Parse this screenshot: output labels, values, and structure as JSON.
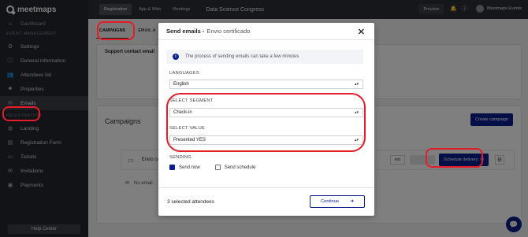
{
  "app": {
    "logo_text": "meetmaps"
  },
  "sidebar": {
    "partial_item": "Dashboard",
    "event_section": "EVENT MANAGEMENT",
    "event_items": [
      {
        "label": "Settings",
        "icon": "gear-icon"
      },
      {
        "label": "General information",
        "icon": "info-icon"
      },
      {
        "label": "Attendees list",
        "icon": "users-icon"
      },
      {
        "label": "Properties",
        "icon": "tag-icon"
      },
      {
        "label": "Emails",
        "icon": "mail-icon"
      }
    ],
    "registration_section": "REGISTRATION",
    "registration_items": [
      {
        "label": "Landing",
        "icon": "globe-icon"
      },
      {
        "label": "Registration Form",
        "icon": "form-icon"
      },
      {
        "label": "Tickets",
        "icon": "ticket-icon"
      },
      {
        "label": "Invitations",
        "icon": "invitation-icon"
      },
      {
        "label": "Payments",
        "icon": "payment-icon"
      }
    ],
    "help": "Help Center"
  },
  "topbar": {
    "tabs": [
      "Registration",
      "App & Web",
      "Meetings"
    ],
    "event_title": "Data Science Congress",
    "preview": "Preview",
    "org_name": "Meetmaps Events"
  },
  "main": {
    "subtabs": [
      "CAMPAIGNS",
      "EMAIL A"
    ],
    "support_title": "Support contact email",
    "campaigns_title": "Campaigns",
    "create_campaign": "Create campaign",
    "row_name": "Envio ce",
    "test_label": "est",
    "schedule_label": "Schedule delivery",
    "no_email": "No email"
  },
  "modal": {
    "title": "Send emails -",
    "subtitle": "Envio certificado",
    "info": "The process of sending emails can take a few minutes",
    "languages_label": "LANGUAGES",
    "language_value": "English",
    "segment_label": "SELECT SEGMENT",
    "segment_value": "Check-in",
    "value_label": "SELECT VALUE",
    "value_value": "Presented YES",
    "sending_label": "SENDING",
    "send_now": "Send now",
    "send_schedule": "Send schedule",
    "send_now_checked": true,
    "send_schedule_checked": false,
    "selected_attendees": "3 selected attendees",
    "continue": "Continue"
  },
  "colors": {
    "accent": "#0b1f8f",
    "highlight": "#e31d2a",
    "sidebar": "#23272e"
  }
}
